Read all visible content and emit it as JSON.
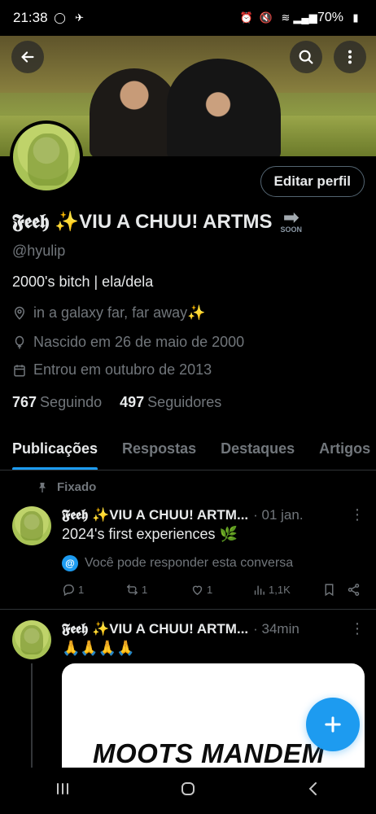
{
  "status_bar": {
    "time": "21:38",
    "battery": "70%"
  },
  "profile": {
    "display_name": "𝕱𝖊𝖊𝖍 ✨VIU A CHUU! ARTMS",
    "soon_label": "SOON",
    "handle": "@hyulip",
    "edit_button": "Editar perfil",
    "bio": "2000's bitch | ela/dela",
    "location": "in a galaxy far, far away✨",
    "birthday": "Nascido em 26 de maio de 2000",
    "joined": "Entrou em outubro de 2013",
    "following_count": "767",
    "following_label": "Seguindo",
    "followers_count": "497",
    "followers_label": "Seguidores"
  },
  "tabs": [
    {
      "label": "Publicações",
      "active": true
    },
    {
      "label": "Respostas",
      "active": false
    },
    {
      "label": "Destaques",
      "active": false
    },
    {
      "label": "Artigos",
      "active": false
    }
  ],
  "posts": [
    {
      "pinned_label": "Fixado",
      "author": "𝕱𝖊𝖊𝖍 ✨VIU A CHUU! ARTM...",
      "time": "· 01 jan.",
      "text": "2024's first experiences 🌿",
      "reply_note": "Você pode responder esta conversa",
      "replies": "1",
      "reposts": "1",
      "likes": "1",
      "views": "1,1K"
    },
    {
      "author": "𝕱𝖊𝖊𝖍 ✨VIU A CHUU! ARTM...",
      "time": "· 34min",
      "text": "🙏🙏🙏🙏",
      "media_text": "MOOTS MANDEM"
    }
  ],
  "colors": {
    "accent": "#1d9bf0",
    "background": "#000000",
    "text_primary": "#e7e9ea",
    "text_secondary": "#71767b"
  }
}
